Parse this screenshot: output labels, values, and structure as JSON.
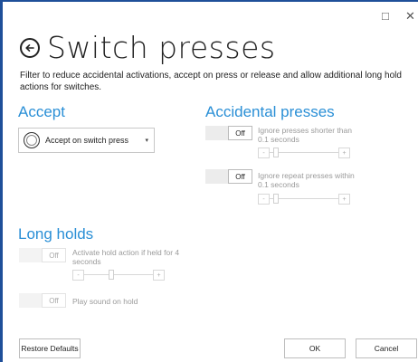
{
  "window": {
    "maximize_glyph": "□",
    "close_glyph": "✕"
  },
  "header": {
    "title": "Switch presses",
    "back_icon": "arrow-left-circle-icon"
  },
  "description": "Filter to reduce accidental activations, accept on press or release and allow additional long hold actions for switches.",
  "accept": {
    "title": "Accept",
    "dropdown": {
      "selected": "Accept on switch press",
      "chevron": "▾"
    }
  },
  "accidental": {
    "title": "Accidental presses",
    "options": [
      {
        "toggle": "Off",
        "label": "Ignore presses shorter than 0.1 seconds"
      },
      {
        "toggle": "Off",
        "label": "Ignore repeat presses within 0.1 seconds"
      }
    ]
  },
  "long_holds": {
    "title": "Long holds",
    "options": [
      {
        "toggle": "Off",
        "label": "Activate hold action if held for 4 seconds"
      },
      {
        "toggle": "Off",
        "label": "Play sound on hold"
      }
    ]
  },
  "stepper": {
    "minus": "-",
    "plus": "+"
  },
  "footer": {
    "restore": "Restore Defaults",
    "ok": "OK",
    "cancel": "Cancel"
  }
}
